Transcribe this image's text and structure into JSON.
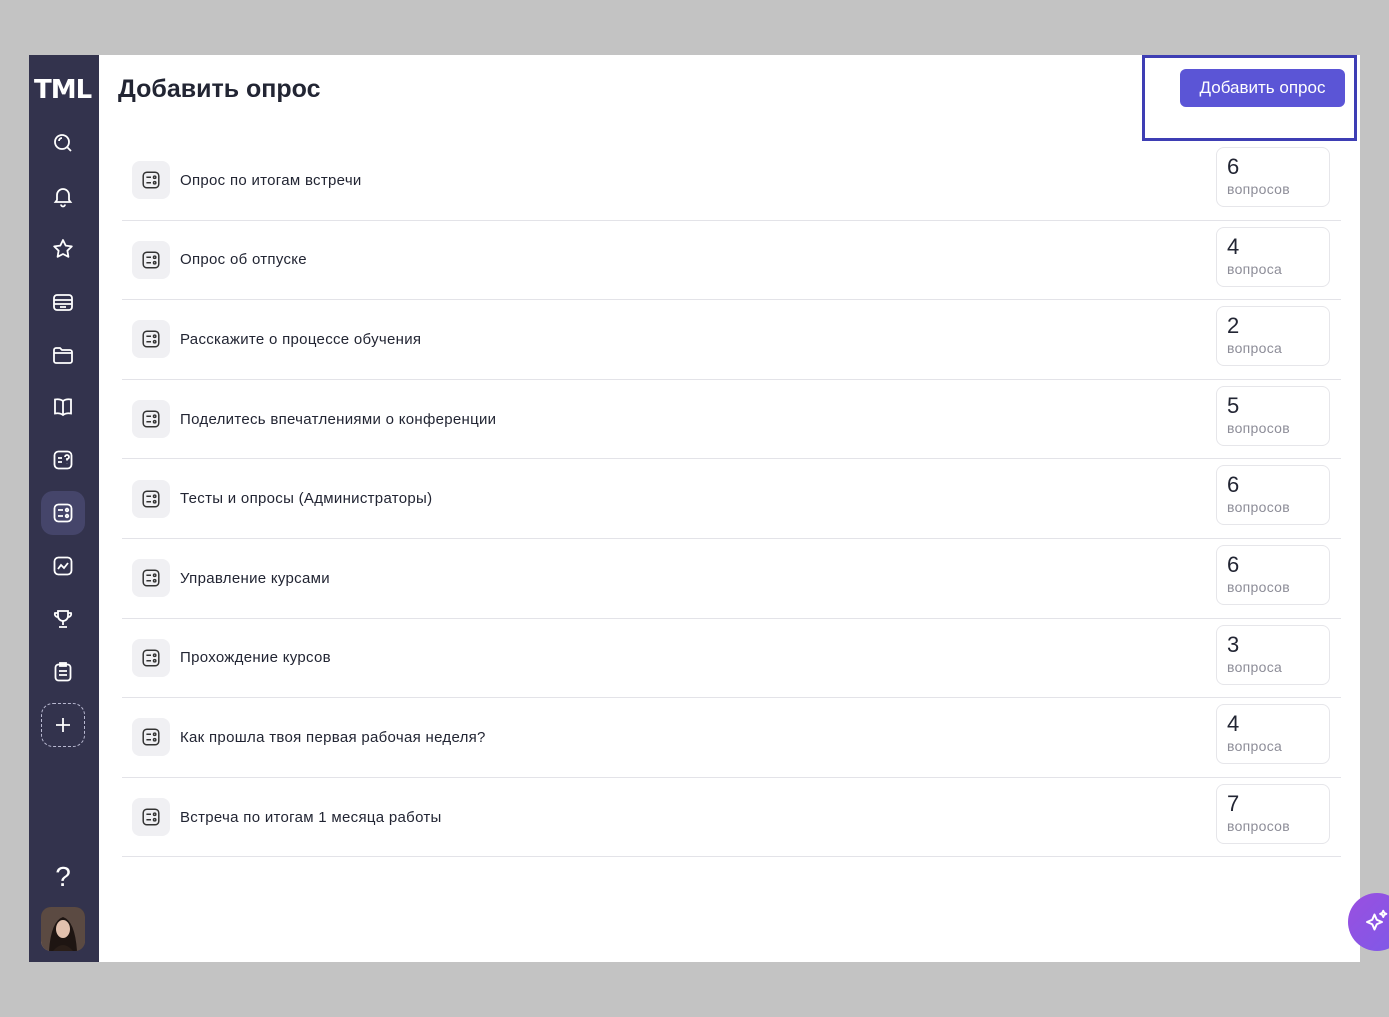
{
  "brand": {
    "logo_text": "TML"
  },
  "header": {
    "title": "Добавить опрос",
    "add_button_label": "Добавить опрос"
  },
  "sidebar": {
    "items": [
      {
        "icon": "search-icon"
      },
      {
        "icon": "bell-icon"
      },
      {
        "icon": "star-icon"
      },
      {
        "icon": "archive-icon"
      },
      {
        "icon": "folder-icon"
      },
      {
        "icon": "book-icon"
      },
      {
        "icon": "quiz-icon"
      },
      {
        "icon": "survey-icon",
        "active": true
      },
      {
        "icon": "chart-icon"
      },
      {
        "icon": "trophy-icon"
      },
      {
        "icon": "clipboard-icon"
      },
      {
        "icon": "plus-icon"
      }
    ],
    "help_label": "?"
  },
  "surveys": [
    {
      "title": "Опрос по итогам встречи",
      "count": "6",
      "unit": "вопросов"
    },
    {
      "title": "Опрос об отпуске",
      "count": "4",
      "unit": "вопроса"
    },
    {
      "title": "Расскажите о процессе обучения",
      "count": "2",
      "unit": "вопроса"
    },
    {
      "title": "Поделитесь впечатлениями о конференции",
      "count": "5",
      "unit": "вопросов"
    },
    {
      "title": "Тесты и опросы (Администраторы)",
      "count": "6",
      "unit": "вопросов"
    },
    {
      "title": "Управление курсами",
      "count": "6",
      "unit": "вопросов"
    },
    {
      "title": "Прохождение курсов",
      "count": "3",
      "unit": "вопроса"
    },
    {
      "title": "Как прошла твоя первая рабочая неделя?",
      "count": "4",
      "unit": "вопроса"
    },
    {
      "title": "Встреча по итогам 1 месяца работы",
      "count": "7",
      "unit": "вопросов"
    }
  ],
  "colors": {
    "sidebar_bg": "#33334d",
    "accent": "#5b55d6",
    "highlight": "#3e3eb4"
  }
}
